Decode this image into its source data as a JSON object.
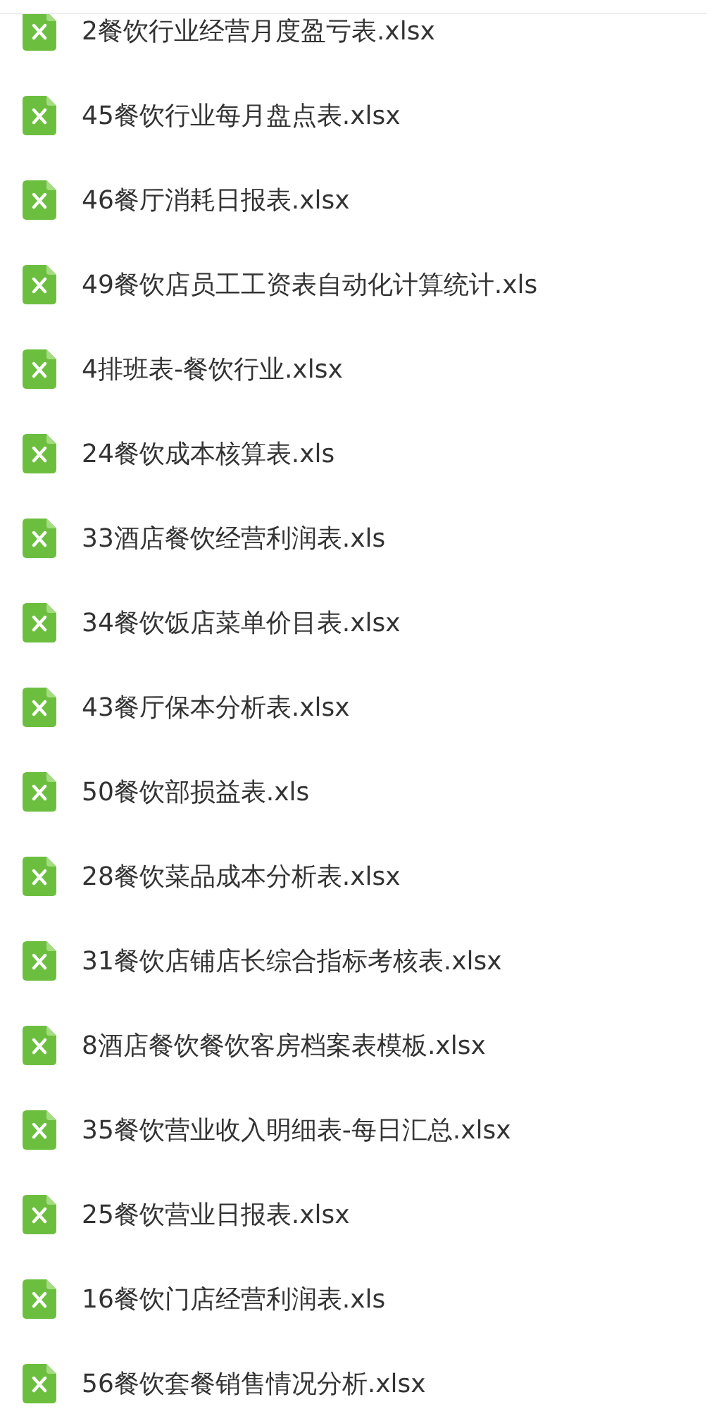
{
  "files": [
    {
      "name": "2餐饮行业经营月度盈亏表.xlsx"
    },
    {
      "name": "45餐饮行业每月盘点表.xlsx"
    },
    {
      "name": "46餐厅消耗日报表.xlsx"
    },
    {
      "name": "49餐饮店员工工资表自动化计算统计.xls"
    },
    {
      "name": "4排班表-餐饮行业.xlsx"
    },
    {
      "name": "24餐饮成本核算表.xls"
    },
    {
      "name": "33酒店餐饮经营利润表.xls"
    },
    {
      "name": "34餐饮饭店菜单价目表.xlsx"
    },
    {
      "name": "43餐厅保本分析表.xlsx"
    },
    {
      "name": "50餐饮部损益表.xls"
    },
    {
      "name": "28餐饮菜品成本分析表.xlsx"
    },
    {
      "name": "31餐饮店铺店长综合指标考核表.xlsx"
    },
    {
      "name": "8酒店餐饮餐饮客房档案表模板.xlsx"
    },
    {
      "name": "35餐饮营业收入明细表-每日汇总.xlsx"
    },
    {
      "name": "25餐饮营业日报表.xlsx"
    },
    {
      "name": "16餐饮门店经营利润表.xls"
    },
    {
      "name": "56餐饮套餐销售情况分析.xlsx"
    }
  ]
}
